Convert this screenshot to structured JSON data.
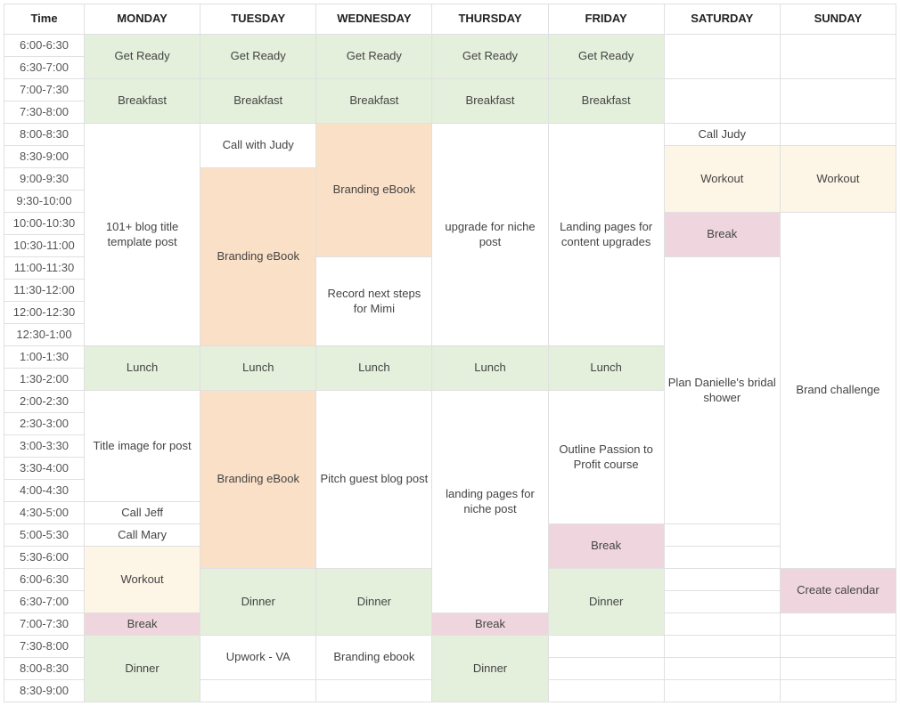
{
  "headers": [
    "Time",
    "MONDAY",
    "TUESDAY",
    "WEDNESDAY",
    "THURSDAY",
    "FRIDAY",
    "SATURDAY",
    "SUNDAY"
  ],
  "times": [
    "6:00-6:30",
    "6:30-7:00",
    "7:00-7:30",
    "7:30-8:00",
    "8:00-8:30",
    "8:30-9:00",
    "9:00-9:30",
    "9:30-10:00",
    "10:00-10:30",
    "10:30-11:00",
    "11:00-11:30",
    "11:30-12:00",
    "12:00-12:30",
    "12:30-1:00",
    "1:00-1:30",
    "1:30-2:00",
    "2:00-2:30",
    "2:30-3:00",
    "3:00-3:30",
    "3:30-4:00",
    "4:00-4:30",
    "4:30-5:00",
    "5:00-5:30",
    "5:30-6:00",
    "6:00-6:30",
    "6:30-7:00",
    "7:00-7:30",
    "7:30-8:00",
    "8:00-8:30",
    "8:30-9:00"
  ],
  "events": [
    {
      "col": 1,
      "row": 0,
      "span": 2,
      "text": "Get Ready",
      "cls": "c-green"
    },
    {
      "col": 2,
      "row": 0,
      "span": 2,
      "text": "Get Ready",
      "cls": "c-green"
    },
    {
      "col": 3,
      "row": 0,
      "span": 2,
      "text": "Get Ready",
      "cls": "c-green"
    },
    {
      "col": 4,
      "row": 0,
      "span": 2,
      "text": "Get Ready",
      "cls": "c-green"
    },
    {
      "col": 5,
      "row": 0,
      "span": 2,
      "text": "Get Ready",
      "cls": "c-green"
    },
    {
      "col": 6,
      "row": 0,
      "span": 2,
      "text": "",
      "cls": "c-white"
    },
    {
      "col": 7,
      "row": 0,
      "span": 2,
      "text": "",
      "cls": "c-white"
    },
    {
      "col": 1,
      "row": 2,
      "span": 2,
      "text": "Breakfast",
      "cls": "c-green"
    },
    {
      "col": 2,
      "row": 2,
      "span": 2,
      "text": "Breakfast",
      "cls": "c-green"
    },
    {
      "col": 3,
      "row": 2,
      "span": 2,
      "text": "Breakfast",
      "cls": "c-green"
    },
    {
      "col": 4,
      "row": 2,
      "span": 2,
      "text": "Breakfast",
      "cls": "c-green"
    },
    {
      "col": 5,
      "row": 2,
      "span": 2,
      "text": "Breakfast",
      "cls": "c-green"
    },
    {
      "col": 6,
      "row": 2,
      "span": 2,
      "text": "",
      "cls": "c-white"
    },
    {
      "col": 7,
      "row": 2,
      "span": 2,
      "text": "",
      "cls": "c-white"
    },
    {
      "col": 1,
      "row": 4,
      "span": 10,
      "text": "101+ blog title template post",
      "cls": "c-white"
    },
    {
      "col": 2,
      "row": 4,
      "span": 2,
      "text": "Call with Judy",
      "cls": "c-white"
    },
    {
      "col": 2,
      "row": 6,
      "span": 8,
      "text": "Branding eBook",
      "cls": "c-orange"
    },
    {
      "col": 3,
      "row": 4,
      "span": 6,
      "text": "Branding eBook",
      "cls": "c-orange"
    },
    {
      "col": 3,
      "row": 10,
      "span": 4,
      "text": "Record next steps for Mimi",
      "cls": "c-white"
    },
    {
      "col": 4,
      "row": 4,
      "span": 10,
      "text": "upgrade for niche post",
      "cls": "c-white"
    },
    {
      "col": 5,
      "row": 4,
      "span": 10,
      "text": "Landing pages for content upgrades",
      "cls": "c-white"
    },
    {
      "col": 6,
      "row": 4,
      "span": 1,
      "text": "Call Judy",
      "cls": "c-white"
    },
    {
      "col": 6,
      "row": 5,
      "span": 3,
      "text": "Workout",
      "cls": "c-cream"
    },
    {
      "col": 6,
      "row": 8,
      "span": 2,
      "text": "Break",
      "cls": "c-pink"
    },
    {
      "col": 6,
      "row": 10,
      "span": 12,
      "text": "Plan Danielle's bridal shower",
      "cls": "c-white"
    },
    {
      "col": 7,
      "row": 4,
      "span": 1,
      "text": "",
      "cls": "c-white"
    },
    {
      "col": 7,
      "row": 5,
      "span": 3,
      "text": "Workout",
      "cls": "c-cream"
    },
    {
      "col": 7,
      "row": 8,
      "span": 16,
      "text": "Brand challenge",
      "cls": "c-white"
    },
    {
      "col": 1,
      "row": 14,
      "span": 2,
      "text": "Lunch",
      "cls": "c-green"
    },
    {
      "col": 2,
      "row": 14,
      "span": 2,
      "text": "Lunch",
      "cls": "c-green"
    },
    {
      "col": 3,
      "row": 14,
      "span": 2,
      "text": "Lunch",
      "cls": "c-green"
    },
    {
      "col": 4,
      "row": 14,
      "span": 2,
      "text": "Lunch",
      "cls": "c-green"
    },
    {
      "col": 5,
      "row": 14,
      "span": 2,
      "text": "Lunch",
      "cls": "c-green"
    },
    {
      "col": 1,
      "row": 16,
      "span": 5,
      "text": "Title image for post",
      "cls": "c-white"
    },
    {
      "col": 1,
      "row": 21,
      "span": 1,
      "text": "Call Jeff",
      "cls": "c-white"
    },
    {
      "col": 1,
      "row": 22,
      "span": 1,
      "text": "Call Mary",
      "cls": "c-white"
    },
    {
      "col": 1,
      "row": 23,
      "span": 3,
      "text": "Workout",
      "cls": "c-cream"
    },
    {
      "col": 1,
      "row": 26,
      "span": 1,
      "text": "Break",
      "cls": "c-pink"
    },
    {
      "col": 1,
      "row": 27,
      "span": 3,
      "text": "Dinner",
      "cls": "c-green"
    },
    {
      "col": 2,
      "row": 16,
      "span": 8,
      "text": "Branding eBook",
      "cls": "c-orange"
    },
    {
      "col": 2,
      "row": 24,
      "span": 3,
      "text": "Dinner",
      "cls": "c-green"
    },
    {
      "col": 2,
      "row": 27,
      "span": 2,
      "text": "Upwork - VA",
      "cls": "c-white"
    },
    {
      "col": 2,
      "row": 29,
      "span": 1,
      "text": "",
      "cls": "c-white"
    },
    {
      "col": 3,
      "row": 16,
      "span": 8,
      "text": "Pitch guest blog post",
      "cls": "c-white"
    },
    {
      "col": 3,
      "row": 24,
      "span": 3,
      "text": "Dinner",
      "cls": "c-green"
    },
    {
      "col": 3,
      "row": 27,
      "span": 2,
      "text": "Branding ebook",
      "cls": "c-white"
    },
    {
      "col": 3,
      "row": 29,
      "span": 1,
      "text": "",
      "cls": "c-white"
    },
    {
      "col": 4,
      "row": 16,
      "span": 10,
      "text": "landing pages for niche post",
      "cls": "c-white"
    },
    {
      "col": 4,
      "row": 26,
      "span": 1,
      "text": "Break",
      "cls": "c-pink"
    },
    {
      "col": 4,
      "row": 27,
      "span": 3,
      "text": "Dinner",
      "cls": "c-green"
    },
    {
      "col": 5,
      "row": 16,
      "span": 6,
      "text": "Outline Passion to Profit course",
      "cls": "c-white"
    },
    {
      "col": 5,
      "row": 22,
      "span": 2,
      "text": "Break",
      "cls": "c-pink"
    },
    {
      "col": 5,
      "row": 24,
      "span": 3,
      "text": "Dinner",
      "cls": "c-green"
    },
    {
      "col": 5,
      "row": 27,
      "span": 1,
      "text": "",
      "cls": "c-white"
    },
    {
      "col": 5,
      "row": 28,
      "span": 1,
      "text": "",
      "cls": "c-white"
    },
    {
      "col": 5,
      "row": 29,
      "span": 1,
      "text": "",
      "cls": "c-white"
    },
    {
      "col": 6,
      "row": 22,
      "span": 1,
      "text": "",
      "cls": "c-white"
    },
    {
      "col": 6,
      "row": 23,
      "span": 1,
      "text": "",
      "cls": "c-white"
    },
    {
      "col": 6,
      "row": 24,
      "span": 1,
      "text": "",
      "cls": "c-white"
    },
    {
      "col": 6,
      "row": 25,
      "span": 1,
      "text": "",
      "cls": "c-white"
    },
    {
      "col": 6,
      "row": 26,
      "span": 1,
      "text": "",
      "cls": "c-white"
    },
    {
      "col": 6,
      "row": 27,
      "span": 1,
      "text": "",
      "cls": "c-white"
    },
    {
      "col": 6,
      "row": 28,
      "span": 1,
      "text": "",
      "cls": "c-white"
    },
    {
      "col": 6,
      "row": 29,
      "span": 1,
      "text": "",
      "cls": "c-white"
    },
    {
      "col": 7,
      "row": 24,
      "span": 2,
      "text": "Create calendar",
      "cls": "c-pink"
    },
    {
      "col": 7,
      "row": 26,
      "span": 1,
      "text": "",
      "cls": "c-white"
    },
    {
      "col": 7,
      "row": 27,
      "span": 1,
      "text": "",
      "cls": "c-white"
    },
    {
      "col": 7,
      "row": 28,
      "span": 1,
      "text": "",
      "cls": "c-white"
    },
    {
      "col": 7,
      "row": 29,
      "span": 1,
      "text": "",
      "cls": "c-white"
    }
  ]
}
